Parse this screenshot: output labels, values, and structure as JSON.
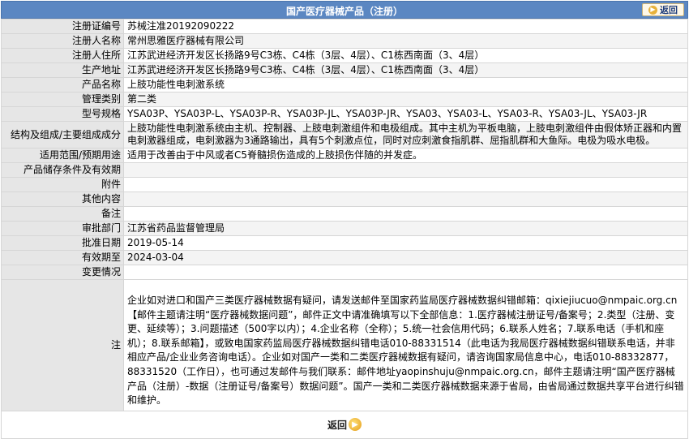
{
  "header": {
    "title": "国产医疗器械产品（注册）",
    "back_label": "返回"
  },
  "rows": [
    {
      "label": "注册证编号",
      "value": "苏械注准20192090222"
    },
    {
      "label": "注册人名称",
      "value": "常州思雅医疗器械有限公司"
    },
    {
      "label": "注册人住所",
      "value": "江苏武进经济开发区长扬路9号C3栋、C4栋（3层、4层）、C1栋西南面（3、4层）"
    },
    {
      "label": "生产地址",
      "value": "江苏武进经济开发区长扬路9号C3栋、C4栋（3层、4层）、C1栋西南面（3、4层）"
    },
    {
      "label": "产品名称",
      "value": "上肢功能性电刺激系统"
    },
    {
      "label": "管理类别",
      "value": "第二类"
    },
    {
      "label": "型号规格",
      "value": "YSA03P、YSA03P-L、YSA03P-R、YSA03P-JL、YSA03P-JR、YSA03、YSA03-L、YSA03-R、YSA03-JL、YSA03-JR"
    },
    {
      "label": "结构及组成/主要组成成分",
      "value": "上肢功能性电刺激系统由主机、控制器、上肢电刺激组件和电极组成。其中主机为平板电脑，上肢电刺激组件由假体矫正器和内置电刺激器组成，电刺激器为3通路输出，具有5个刺激点位，同时对应刺激食指肌群、屈指肌群和大鱼际。电极为吸水电极。"
    },
    {
      "label": "适用范围/预期用途",
      "value": "适用于改善由于中风或者C5脊髓损伤造成的上肢损伤伴随的并发症。"
    },
    {
      "label": "产品储存条件及有效期",
      "value": ""
    },
    {
      "label": "附件",
      "value": ""
    },
    {
      "label": "其他内容",
      "value": ""
    },
    {
      "label": "备注",
      "value": ""
    },
    {
      "label": "审批部门",
      "value": "江苏省药品监督管理局"
    },
    {
      "label": "批准日期",
      "value": "2019-05-14"
    },
    {
      "label": "有效期至",
      "value": "2024-03-04"
    },
    {
      "label": "变更情况",
      "value": ""
    }
  ],
  "note": {
    "label": "注",
    "text": "企业如对进口和国产三类医疗器械数据有疑问，请发送邮件至国家药监局医疗器械数据纠错邮箱：qixiejiucuo@nmpaic.org.cn【邮件主题请注明“医疗器械数据问题”，邮件正文中请准确填写以下全部信息：1.医疗器械注册证号/备案号；2.类型（注册、变更、延续等）；3.问题描述（500字以内）；4.企业名称（全称）；5.统一社会信用代码；6.联系人姓名；7.联系电话（手机和座机）；8.联系邮箱】，或致电国家药监局医疗器械数据纠错电话010-88331514（此电话为我局医疗器械数据纠错联系电话，并非相应产品/企业业务咨询电话）。企业如对国产一类和二类医疗器械数据有疑问，请咨询国家局信息中心，电话010-88332877，88331520（工作日），也可通过发邮件与我们联系：邮件地址yaopinshuju@nmpaic.org.cn，邮件主题请注明“国产医疗器械产品（注册）-数据（注册证号/备案号）数据问题”。国产一类和二类医疗器械数据来源于省局，由省局通过数据共享平台进行纠错和维护。"
  },
  "footer": {
    "back_label": "返回"
  },
  "colors": {
    "header_bg": "#5b87c2",
    "label_bg": "#e6e6e6",
    "alt_row_bg": "#f4f4f4"
  }
}
